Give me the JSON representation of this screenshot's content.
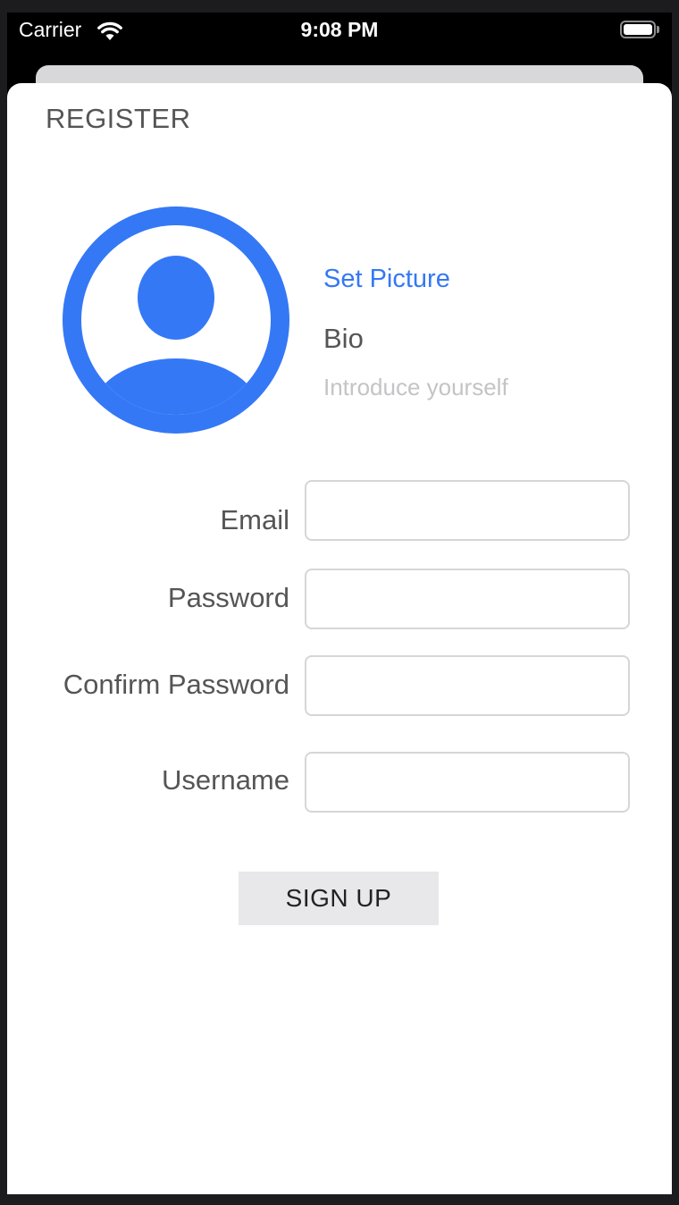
{
  "status_bar": {
    "carrier": "Carrier",
    "time": "9:08 PM",
    "wifi_icon": "wifi-icon",
    "battery_icon": "battery-icon",
    "battery_level": 1.0
  },
  "sheet": {
    "title": "REGISTER"
  },
  "profile": {
    "avatar_icon": "user-circle-icon",
    "set_picture_label": "Set Picture",
    "bio_label": "Bio",
    "bio_value": "",
    "bio_placeholder": "Introduce yourself"
  },
  "form": {
    "fields": [
      {
        "label": "Email",
        "value": ""
      },
      {
        "label": "Password",
        "value": ""
      },
      {
        "label": "Confirm Password",
        "value": ""
      },
      {
        "label": "Username",
        "value": ""
      }
    ],
    "submit_label": "SIGN UP"
  },
  "colors": {
    "accent": "#3478f6",
    "label_text": "#555555",
    "placeholder": "#c4c4c7",
    "button_bg": "#e8e8ea"
  }
}
